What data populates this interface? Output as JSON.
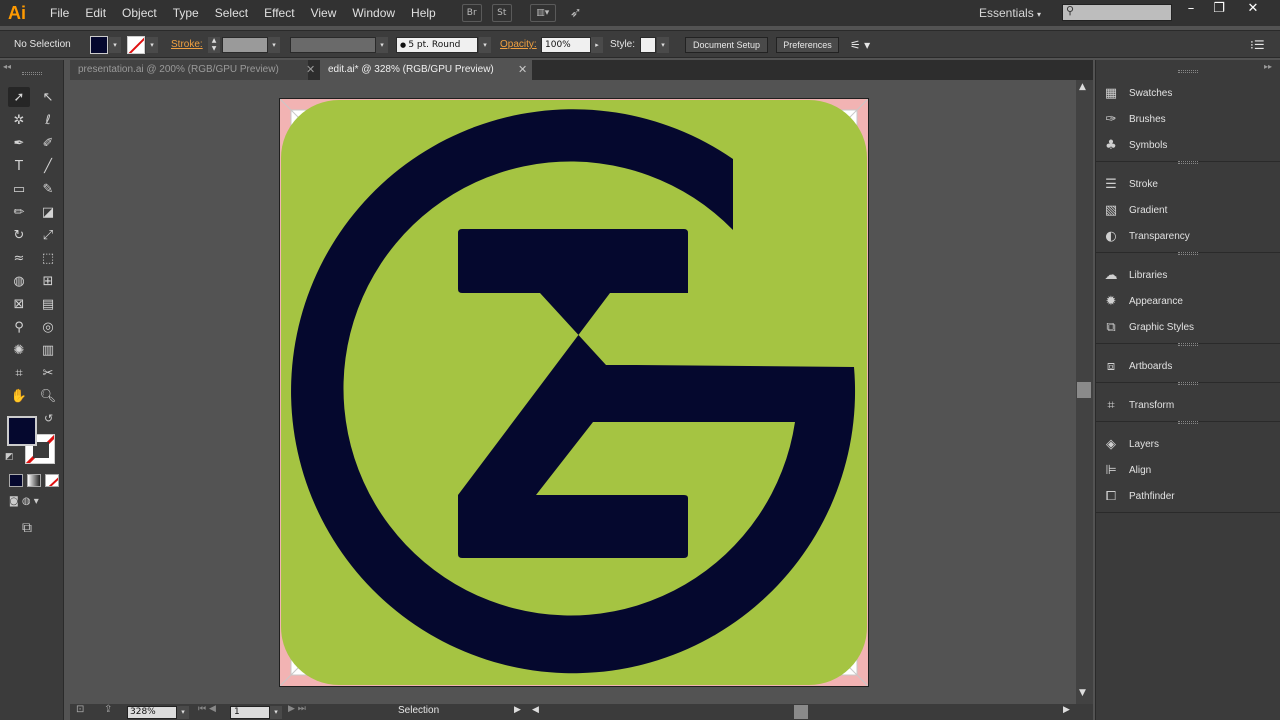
{
  "app": {
    "logo": "Ai"
  },
  "menu": [
    "File",
    "Edit",
    "Object",
    "Type",
    "Select",
    "Effect",
    "View",
    "Window",
    "Help"
  ],
  "menubar_icons": {
    "bridge": "Br",
    "stock": "St"
  },
  "workspace": {
    "label": "Essentials",
    "search_placeholder": ""
  },
  "window_controls": {
    "minimize": "–",
    "restore": "❐",
    "close": "✕"
  },
  "control_bar": {
    "selection_status": "No Selection",
    "fill_color": "#05082e",
    "stroke_label": "Stroke:",
    "brush_value": "5 pt. Round",
    "opacity_label": "Opacity:",
    "opacity_value": "100%",
    "style_label": "Style:",
    "document_setup": "Document Setup",
    "preferences": "Preferences"
  },
  "tabs": [
    {
      "label": "presentation.ai @ 200% (RGB/GPU Preview)",
      "close": "✕",
      "active": false
    },
    {
      "label": "edit.ai* @ 328% (RGB/GPU Preview)",
      "close": "✕",
      "active": true
    }
  ],
  "artwork": {
    "background_color": "#a5c442",
    "logo_color": "#05082e",
    "bleed_color": "#f2b3b3"
  },
  "status_bar": {
    "zoom": "328%",
    "artboard_number": "1",
    "tool_name": "Selection"
  },
  "tools": [
    {
      "icon": "selection-tool-icon",
      "glyph": "➚"
    },
    {
      "icon": "direct-selection-tool-icon",
      "glyph": "↖"
    },
    {
      "icon": "magic-wand-tool-icon",
      "glyph": "✲"
    },
    {
      "icon": "lasso-tool-icon",
      "glyph": "ℓ"
    },
    {
      "icon": "pen-tool-icon",
      "glyph": "✒"
    },
    {
      "icon": "curvature-tool-icon",
      "glyph": "✐"
    },
    {
      "icon": "type-tool-icon",
      "glyph": "T"
    },
    {
      "icon": "line-segment-tool-icon",
      "glyph": "╱"
    },
    {
      "icon": "rectangle-tool-icon",
      "glyph": "▭"
    },
    {
      "icon": "paintbrush-tool-icon",
      "glyph": "✎"
    },
    {
      "icon": "pencil-tool-icon",
      "glyph": "✏"
    },
    {
      "icon": "eraser-tool-icon",
      "glyph": "◪"
    },
    {
      "icon": "rotate-tool-icon",
      "glyph": "↻"
    },
    {
      "icon": "scale-tool-icon",
      "glyph": "⤢"
    },
    {
      "icon": "warp-tool-icon",
      "glyph": "≈"
    },
    {
      "icon": "free-transform-tool-icon",
      "glyph": "⬚"
    },
    {
      "icon": "shape-builder-tool-icon",
      "glyph": "◍"
    },
    {
      "icon": "perspective-grid-tool-icon",
      "glyph": "⊞"
    },
    {
      "icon": "mesh-tool-icon",
      "glyph": "⊠"
    },
    {
      "icon": "gradient-tool-icon",
      "glyph": "▤"
    },
    {
      "icon": "eyedropper-tool-icon",
      "glyph": "⚲"
    },
    {
      "icon": "blend-tool-icon",
      "glyph": "◎"
    },
    {
      "icon": "symbol-sprayer-tool-icon",
      "glyph": "✺"
    },
    {
      "icon": "column-graph-tool-icon",
      "glyph": "▥"
    },
    {
      "icon": "artboard-tool-icon",
      "glyph": "⌗"
    },
    {
      "icon": "slice-tool-icon",
      "glyph": "✂"
    },
    {
      "icon": "hand-tool-icon",
      "glyph": "✋"
    },
    {
      "icon": "zoom-tool-icon",
      "glyph": "🔍︎"
    }
  ],
  "panels": {
    "group1": [
      {
        "name": "swatches",
        "label": "Swatches",
        "glyph": "▦"
      },
      {
        "name": "brushes",
        "label": "Brushes",
        "glyph": "✑"
      },
      {
        "name": "symbols",
        "label": "Symbols",
        "glyph": "♣"
      }
    ],
    "group2": [
      {
        "name": "stroke",
        "label": "Stroke",
        "glyph": "☰"
      },
      {
        "name": "gradient",
        "label": "Gradient",
        "glyph": "▧"
      },
      {
        "name": "transparency",
        "label": "Transparency",
        "glyph": "◐"
      }
    ],
    "group3": [
      {
        "name": "libraries",
        "label": "Libraries",
        "glyph": "☁"
      },
      {
        "name": "appearance",
        "label": "Appearance",
        "glyph": "✹"
      },
      {
        "name": "graphic-styles",
        "label": "Graphic Styles",
        "glyph": "⧉"
      }
    ],
    "group4": [
      {
        "name": "artboards",
        "label": "Artboards",
        "glyph": "⧈"
      }
    ],
    "group5": [
      {
        "name": "transform",
        "label": "Transform",
        "glyph": "⌗"
      }
    ],
    "group6": [
      {
        "name": "layers",
        "label": "Layers",
        "glyph": "◈"
      },
      {
        "name": "align",
        "label": "Align",
        "glyph": "⊫"
      },
      {
        "name": "pathfinder",
        "label": "Pathfinder",
        "glyph": "⧠"
      }
    ]
  }
}
